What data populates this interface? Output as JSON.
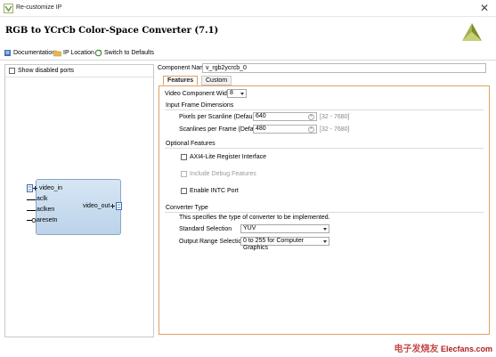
{
  "window": {
    "title": "Re-customize IP",
    "close_glyph": "✕"
  },
  "header": {
    "title": "RGB to YCrCb Color-Space Converter (7.1)"
  },
  "toolbar": {
    "documentation": "Documentation",
    "ip_location": "IP Location",
    "switch_defaults": "Switch to Defaults"
  },
  "left": {
    "show_disabled": "Show disabled ports",
    "ports_left": [
      "video_in",
      "aclk",
      "aclken",
      "aresetn"
    ],
    "port_right": "video_out"
  },
  "component": {
    "label": "Component Name",
    "value": "v_rgb2ycrcb_0"
  },
  "tabs": [
    "Features",
    "Custom"
  ],
  "features": {
    "video_width_label": "Video Component Width",
    "video_width_value": "8",
    "input_frame_title": "Input Frame Dimensions",
    "pixels_label": "Pixels per Scanline (Default)",
    "pixels_value": "640",
    "pixels_range": "[32 - 7680]",
    "scanlines_label": "Scanlines per Frame (Default)",
    "scanlines_value": "480",
    "scanlines_range": "[32 - 7680]",
    "optional_title": "Optional Features",
    "axi_label": "AXI4-Lite Register Interface",
    "debug_label": "Include Debug Features",
    "intc_label": "Enable INTC Port",
    "converter_title": "Converter Type",
    "converter_desc": "This specifies the type of converter to be implemented.",
    "standard_label": "Standard Selection",
    "standard_value": "YUV",
    "output_label": "Output Range Selection",
    "output_value": "0 to 255 for Computer Graphics"
  },
  "watermark": {
    "cn": "电子发烧友",
    "en": "Elecfans.com"
  },
  "colors": {
    "tab_accent": "#e0a060",
    "ip_block": "#c8dcef",
    "xilinx_logo": "#a8b04a"
  }
}
